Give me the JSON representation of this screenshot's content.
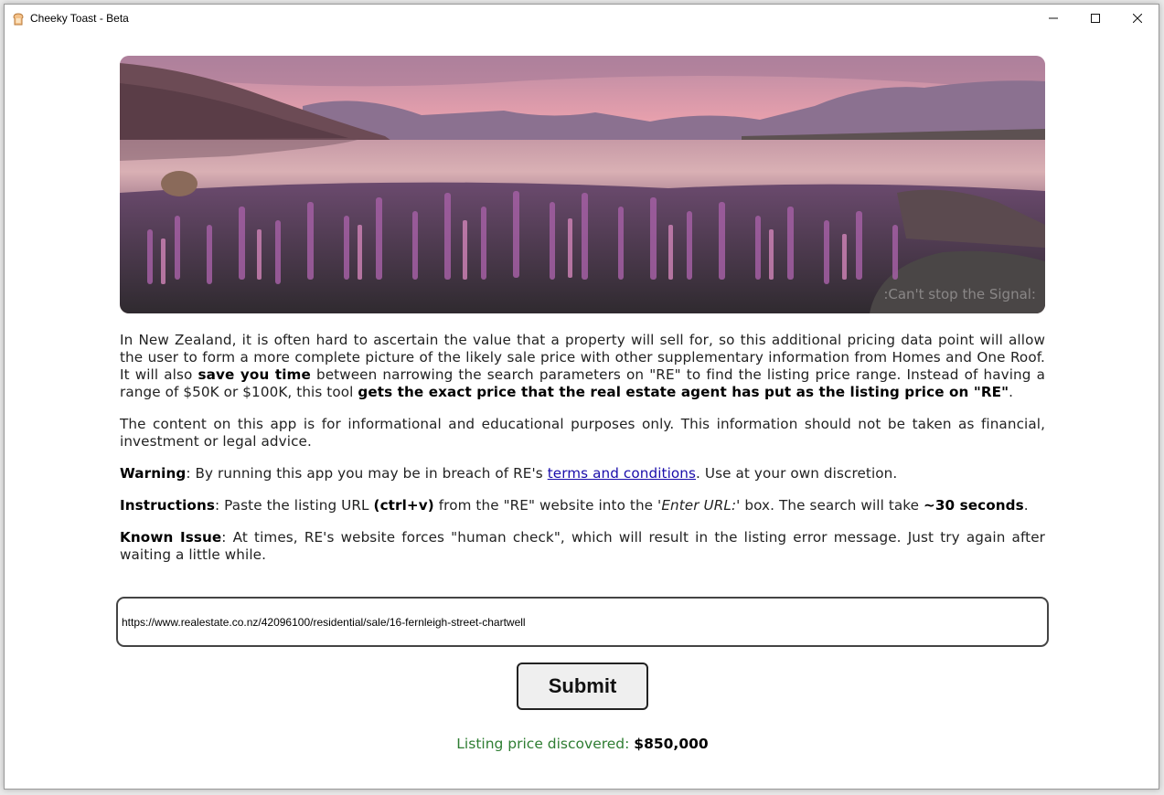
{
  "window": {
    "title": "Cheeky Toast - Beta",
    "controls": {
      "minimize": "—",
      "maximize": "☐",
      "close": "✕"
    }
  },
  "hero": {
    "watermark": ":Can't stop the Signal:"
  },
  "intro": {
    "p1_a": "In New Zealand, it is often hard to ascertain the value that a property will sell for, so this additional pricing data point will allow the user to form a more complete picture of the likely sale price with other supplementary information from Homes and One Roof. It will also ",
    "p1_b": "save you time",
    "p1_c": " between narrowing the search parameters on \"RE\" to find the listing price range. Instead of having a range of $50K or $100K, this tool ",
    "p1_d": "gets the exact price that the real estate agent has put as the listing price on \"RE\"",
    "p1_e": ".",
    "p2": "The content on this app is for informational and educational purposes only. This information should not be taken as financial, investment or legal advice.",
    "warning_label": "Warning",
    "warning_a": ": By running this app you may be in breach of RE's ",
    "warning_link": "terms and conditions",
    "warning_b": ". Use at your own discretion.",
    "instr_label": "Instructions",
    "instr_a": ": Paste the listing URL ",
    "instr_b": "(ctrl+v)",
    "instr_c": " from the \"RE\" website into the ",
    "instr_d": "'Enter URL:'",
    "instr_e": " box. The search will take ",
    "instr_f": "~30 seconds",
    "instr_g": ".",
    "issue_label": "Known Issue",
    "issue_text": ": At times, RE's website forces \"human check\", which will result in the listing error message. Just try again after waiting a little while."
  },
  "url_input": {
    "value": "https://www.realestate.co.nz/42096100/residential/sale/16-fernleigh-street-chartwell"
  },
  "submit": {
    "label": "Submit"
  },
  "result": {
    "label": "Listing price discovered: ",
    "value": "$850,000"
  },
  "colors": {
    "result_label": "#2e7d32",
    "link": "#1a0dab"
  }
}
